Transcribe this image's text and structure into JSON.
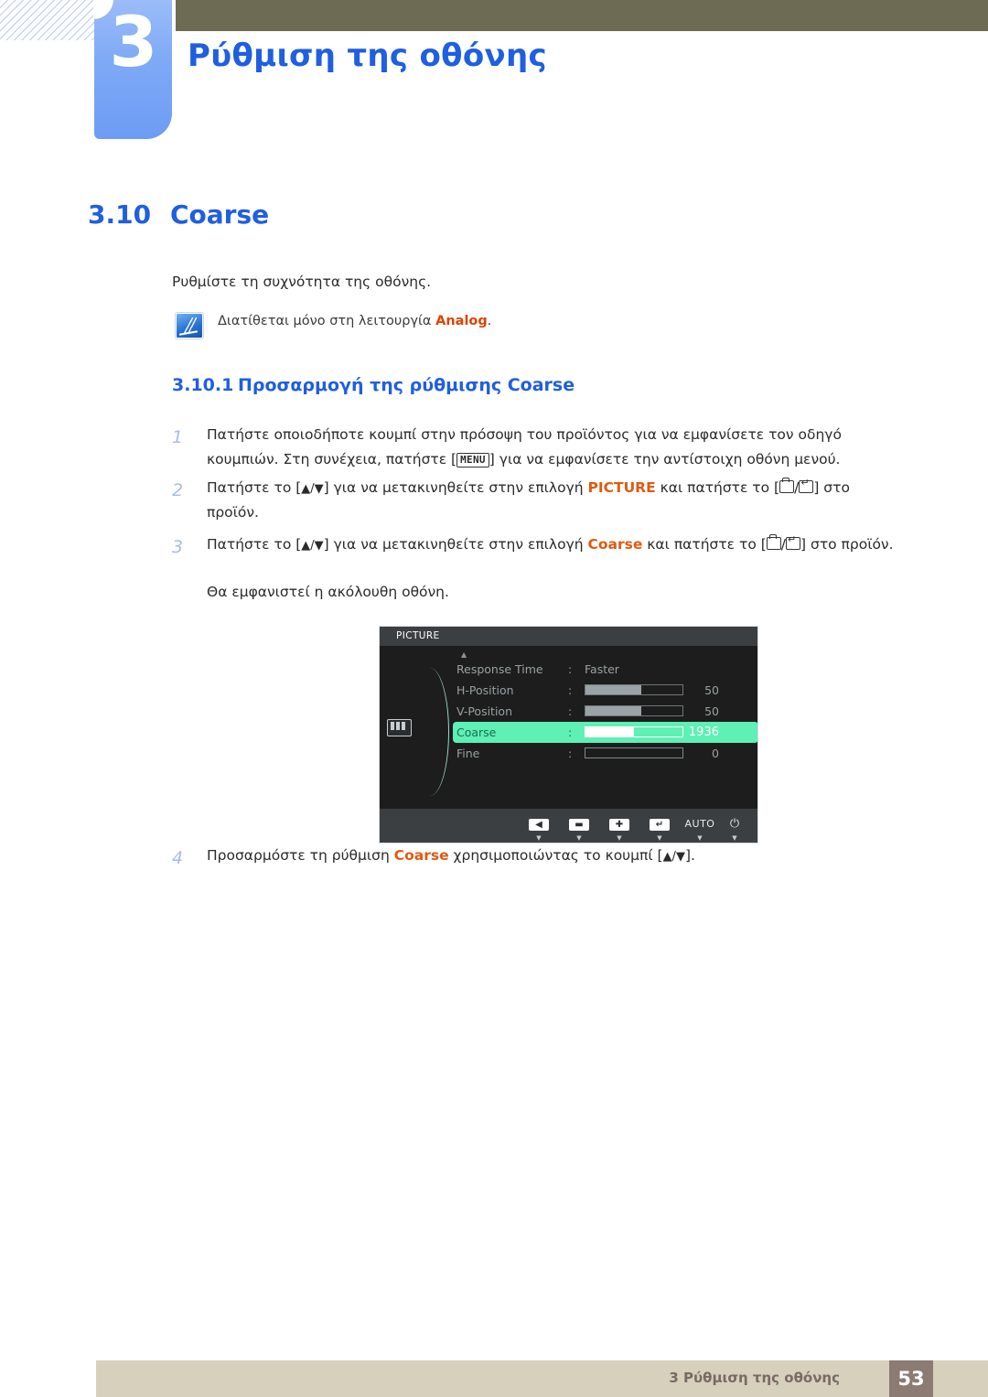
{
  "chapter": {
    "number": "3",
    "title": "Ρύθμιση της οθόνης"
  },
  "section": {
    "number": "3.10",
    "title": "Coarse",
    "intro": "Ρυθμίστε τη συχνότητα της οθόνης."
  },
  "note": {
    "icon": "note-pencil-icon",
    "text_before": "Διατίθεται μόνο στη λειτουργία ",
    "keyword": "Analog",
    "text_after": "."
  },
  "subsection": {
    "number": "3.10.1",
    "title": "Προσαρμογή της ρύθμισης Coarse"
  },
  "steps": {
    "s1": {
      "n": "1",
      "p1": "Πατήστε οποιοδήποτε κουμπί στην πρόσοψη του προϊόντος για να εμφανίσετε τον οδηγό κουμπιών. Στη συνέχεια, πατήστε [",
      "key": "MENU",
      "p2": "] για να εμφανίσετε την αντίστοιχη οθόνη μενού."
    },
    "s2": {
      "n": "2",
      "p1": "Πατήστε το [",
      "updown": "▲/▼",
      "p2": "] για να μετακινηθείτε στην επιλογή ",
      "kw": "PICTURE",
      "p3": " και πατήστε το [",
      "p4": "] στο προϊόν."
    },
    "s3": {
      "n": "3",
      "p1": "Πατήστε το [",
      "updown": "▲/▼",
      "p2": "] για να μετακινηθείτε στην επιλογή ",
      "kw": "Coarse",
      "p3": " και πατήστε το [",
      "p4": "] στο προϊόν."
    },
    "result_text": "Θα εμφανιστεί η ακόλουθη οθόνη.",
    "s4": {
      "n": "4",
      "p1": "Προσαρμόστε τη ρύθμιση ",
      "kw": "Coarse",
      "p2": " χρησιμοποιώντας το κουμπί [",
      "updown": "▲/▼",
      "p3": "]."
    }
  },
  "osd": {
    "title": "PICTURE",
    "category_icon": "picture-bars-icon",
    "scroll_up_icon": "▲",
    "rows": [
      {
        "label": "Response Time",
        "colon": ":",
        "value": "Faster",
        "type": "text"
      },
      {
        "label": "H-Position",
        "colon": ":",
        "number": "50",
        "type": "slider",
        "fill_pct": 58
      },
      {
        "label": "V-Position",
        "colon": ":",
        "number": "50",
        "type": "slider",
        "fill_pct": 58
      },
      {
        "label": "Coarse",
        "colon": ":",
        "number": "1936",
        "type": "slider",
        "fill_pct": 50,
        "selected": true
      },
      {
        "label": "Fine",
        "colon": ":",
        "number": "0",
        "type": "slider",
        "fill_pct": 0
      }
    ],
    "buttons": [
      {
        "name": "back",
        "glyph": "◀",
        "sub": "▼"
      },
      {
        "name": "minus",
        "glyph": "▬",
        "sub": "▼"
      },
      {
        "name": "plus",
        "glyph": "✚",
        "sub": "▼"
      },
      {
        "name": "enter",
        "glyph": "↵",
        "sub": "▼"
      },
      {
        "name": "auto",
        "label": "AUTO",
        "sub": "▼"
      },
      {
        "name": "power",
        "glyph": "⏻",
        "sub": "▼"
      }
    ]
  },
  "footer": {
    "text": "3 Ρύθμιση της οθόνης",
    "page": "53"
  },
  "colors": {
    "accent_blue": "#1f5fe0",
    "keyword_orange": "#e05a10",
    "header_olive": "#6e6b55",
    "tab_blue": "#7ea9f6",
    "footer_bar": "#d6d0bd",
    "footer_page": "#8b7b73",
    "osd_highlight": "#5ef0b4"
  }
}
